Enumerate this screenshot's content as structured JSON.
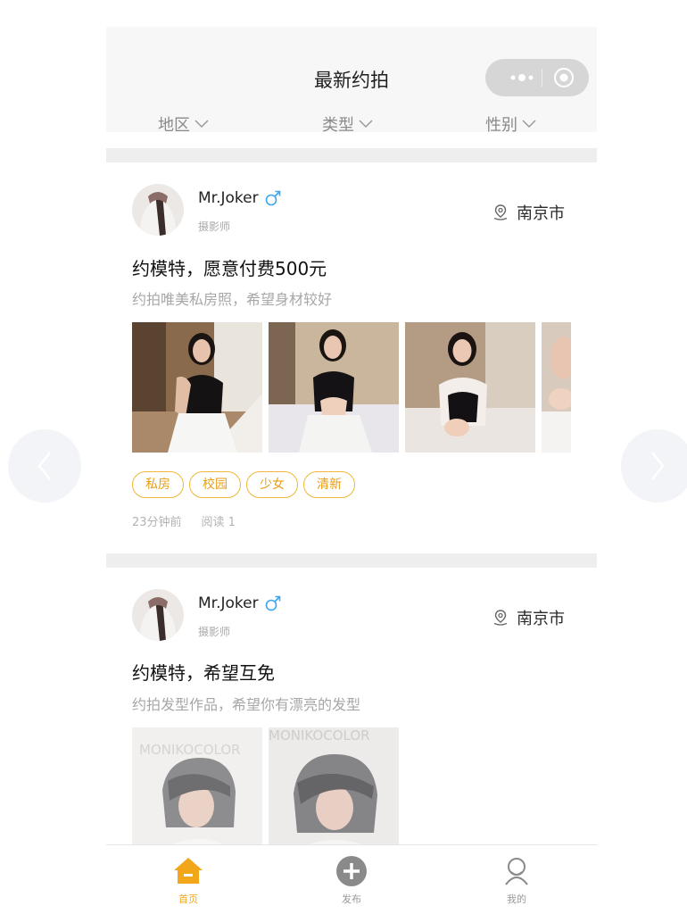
{
  "nav": {
    "title": "最新约拍"
  },
  "filters": [
    {
      "label": "地区"
    },
    {
      "label": "类型"
    },
    {
      "label": "性别"
    }
  ],
  "posts": [
    {
      "user": "Mr.Joker",
      "role": "摄影师",
      "location": "南京市",
      "title": "约模特，愿意付费500元",
      "desc": "约拍唯美私房照，希望身材较好",
      "tags": [
        "私房",
        "校园",
        "少女",
        "清新"
      ],
      "time": "23分钟前",
      "reads": "阅读 1"
    },
    {
      "user": "Mr.Joker",
      "role": "摄影师",
      "location": "南京市",
      "title": "约模特，希望互免",
      "desc": "约拍发型作品，希望你有漂亮的发型",
      "watermark": "MONIKOCOLOR"
    }
  ],
  "tabs": [
    {
      "label": "首页",
      "icon": "home-icon",
      "active": true
    },
    {
      "label": "发布",
      "icon": "plus-circle-icon",
      "active": false
    },
    {
      "label": "我的",
      "icon": "user-icon",
      "active": false
    }
  ],
  "colors": {
    "accent": "#f2a71b",
    "male": "#3aa6f0",
    "band": "#eeeeee"
  }
}
